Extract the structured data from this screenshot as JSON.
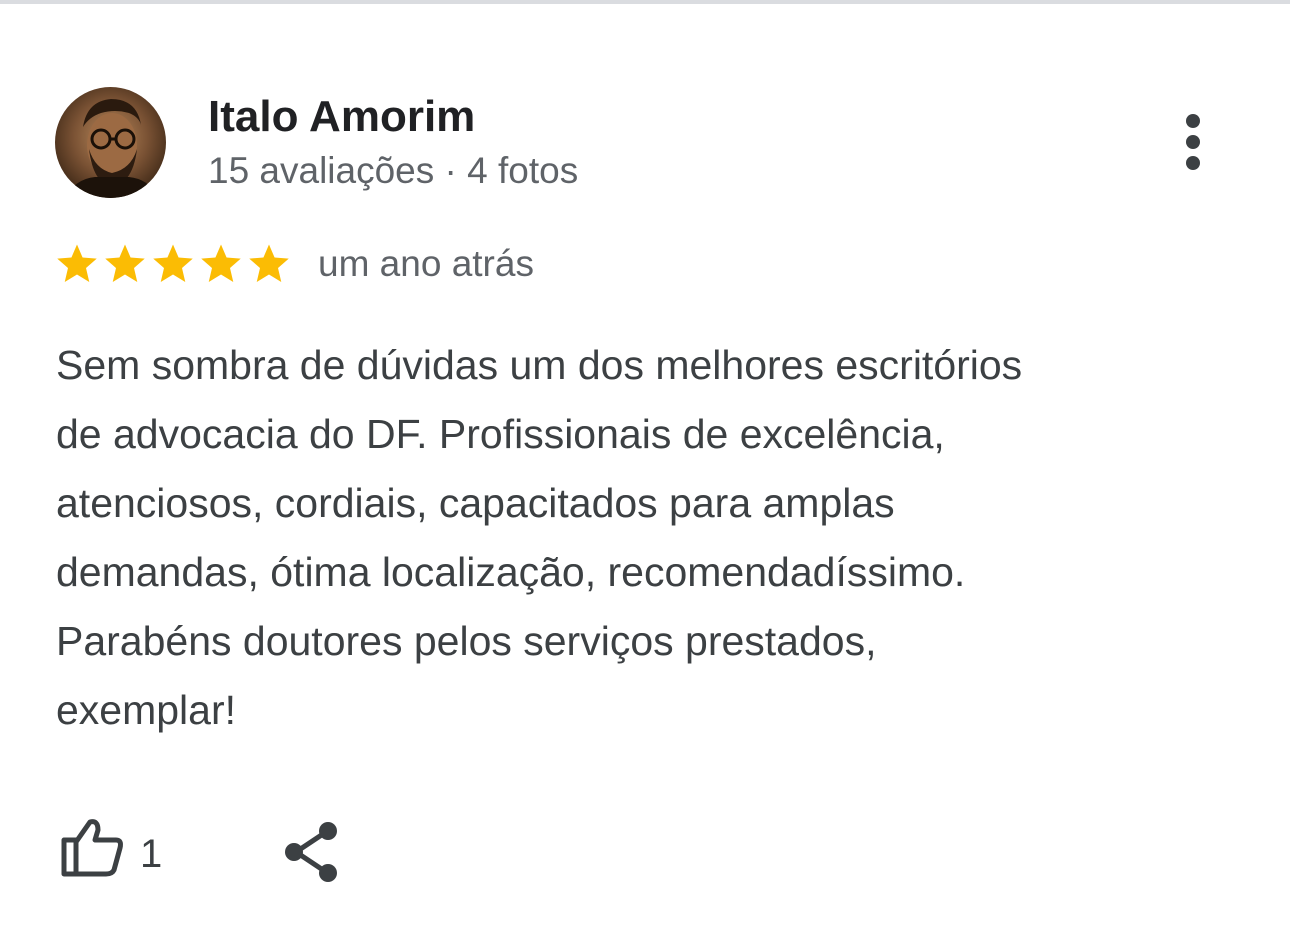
{
  "reviewer": {
    "name": "Italo Amorim",
    "meta": "15 avaliações · 4 fotos",
    "avatar_icon": "avatar-photo"
  },
  "menu": {
    "icon": "more-vert-icon"
  },
  "rating": {
    "stars": 5,
    "max": 5,
    "color": "#fbbc04",
    "time": "um ano atrás"
  },
  "review": {
    "lines": [
      "Sem sombra de dúvidas um dos melhores escritórios",
      "de advocacia do DF. Profissionais de excelência,",
      "atenciosos, cordiais, capacitados para amplas",
      "demandas, ótima localização, recomendadíssimo.",
      "Parabéns doutores pelos serviços prestados,",
      "exemplar!"
    ]
  },
  "actions": {
    "like_icon": "thumbs-up-icon",
    "like_count": "1",
    "share_icon": "share-icon"
  },
  "colors": {
    "text_primary": "#202124",
    "text_secondary": "#5f6368",
    "star": "#fbbc04",
    "divider": "#dadce0"
  }
}
